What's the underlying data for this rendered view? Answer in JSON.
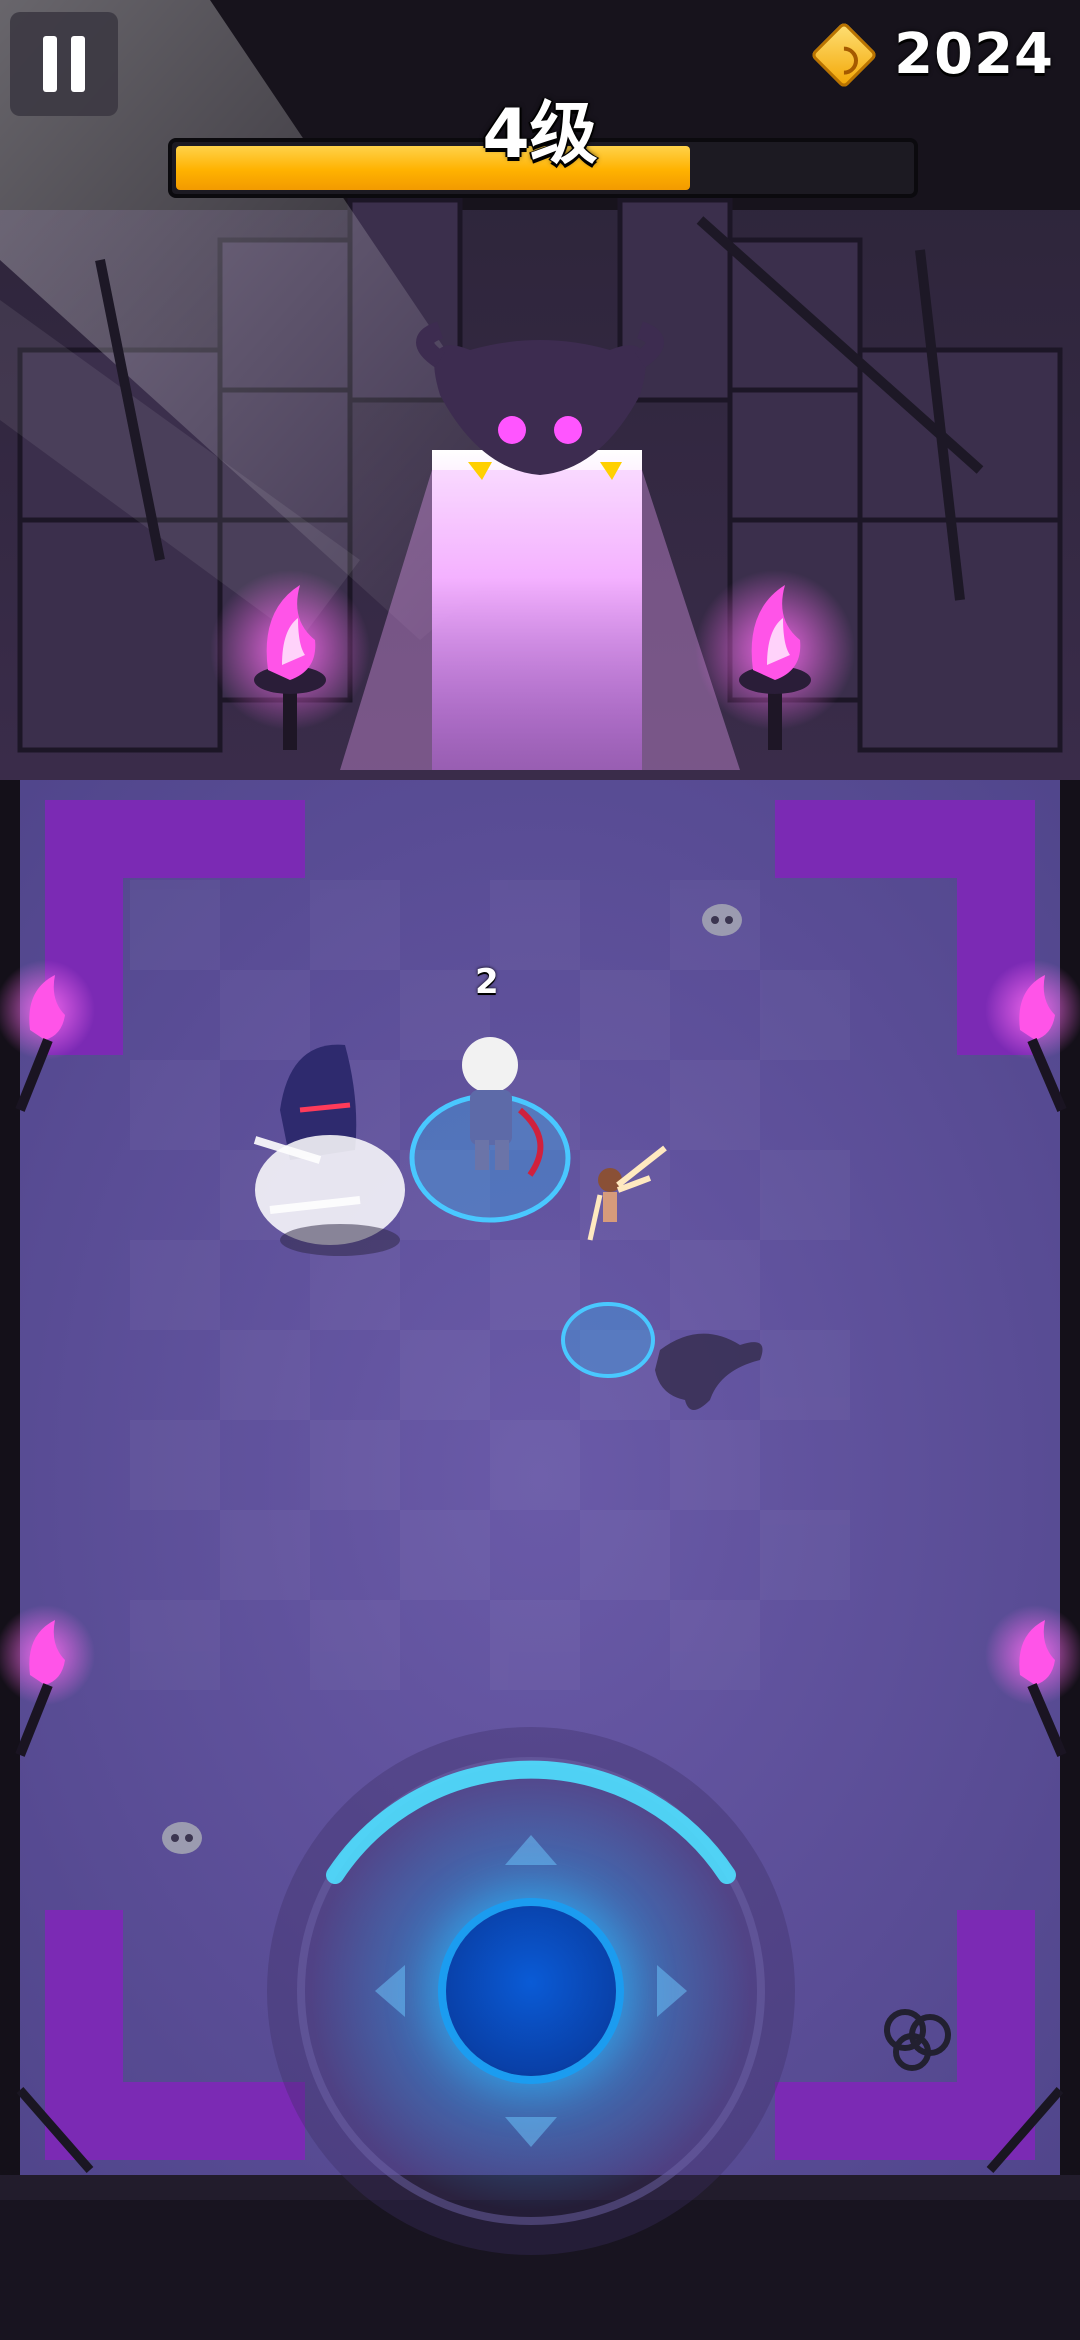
{
  "hud": {
    "coins": "2024",
    "level_label": "4级",
    "xp_progress": 0.7
  },
  "world": {
    "damage_number": "2"
  },
  "colors": {
    "floor": "#6656a4",
    "floor_border": "#7a26b8",
    "portal": "#e070ff",
    "joystick": "#1b9cf0",
    "xp_bar": "#ffb200"
  },
  "icons": [
    "pause-icon",
    "coin-gem-icon",
    "skull-icon",
    "chains-icon",
    "purple-torch-icon",
    "demon-skull-icon"
  ]
}
